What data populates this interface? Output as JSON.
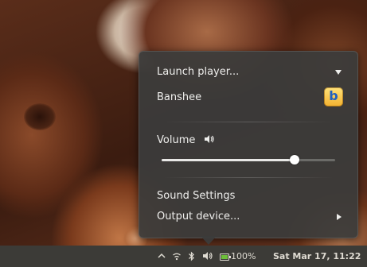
{
  "menu": {
    "launch_player_label": "Launch player...",
    "player_name": "Banshee",
    "player_icon_letter": "b",
    "volume_label": "Volume",
    "volume_level": 0.78,
    "sound_settings_label": "Sound Settings",
    "output_device_label": "Output device..."
  },
  "panel": {
    "battery_percent": "100%",
    "clock": "Sat Mar 17, 11:22"
  },
  "colors": {
    "menu_bg": "#3c3c3a",
    "panel_bg": "#3c3b37",
    "battery_fill": "#6dbf3a",
    "banshee_accent": "#f3b12f"
  },
  "icons": [
    "chevron-up-icon",
    "wifi-icon",
    "bluetooth-icon",
    "volume-icon",
    "battery-icon",
    "banshee-icon",
    "speaker-icon"
  ]
}
